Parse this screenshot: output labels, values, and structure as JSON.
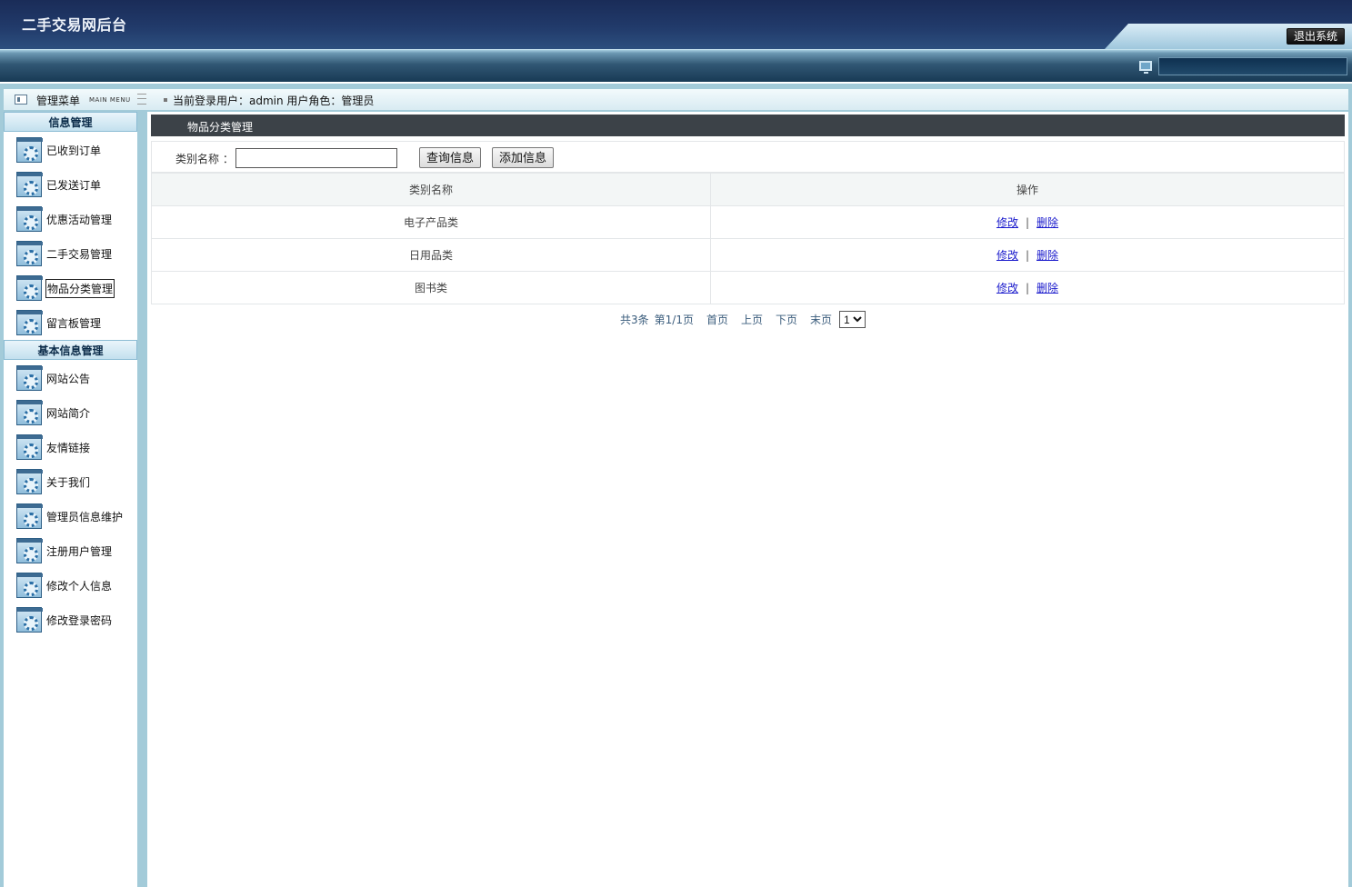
{
  "header": {
    "site_title": "二手交易网后台",
    "exit_label": "退出系统"
  },
  "frame_header": {
    "menu_title": "管理菜单",
    "menu_sub": "MAIN MENU",
    "user_info": "当前登录用户：admin  用户角色：管理员"
  },
  "sidebar": {
    "sections": [
      {
        "title": "信息管理",
        "items": [
          "已收到订单",
          "已发送订单",
          "优惠活动管理",
          "二手交易管理",
          "物品分类管理",
          "留言板管理"
        ]
      },
      {
        "title": "基本信息管理",
        "items": [
          "网站公告",
          "网站简介",
          "友情链接",
          "关于我们",
          "管理员信息维护",
          "注册用户管理",
          "修改个人信息",
          "修改登录密码"
        ]
      }
    ],
    "active_item": "物品分类管理"
  },
  "content": {
    "title": "物品分类管理",
    "search_label": "类别名称 ：",
    "search_value": "",
    "query_button": "查询信息",
    "add_button": "添加信息",
    "table": {
      "headers": [
        "类别名称",
        "操作"
      ],
      "rows": [
        {
          "name": "电子产品类",
          "edit": "修改",
          "delete": "删除"
        },
        {
          "name": "日用品类",
          "edit": "修改",
          "delete": "删除"
        },
        {
          "name": "图书类",
          "edit": "修改",
          "delete": "删除"
        }
      ]
    },
    "pager": {
      "total": "共3条",
      "page_info": "第1/1页",
      "first": "首页",
      "prev": "上页",
      "next": "下页",
      "last": "末页",
      "selected_page": "1"
    }
  },
  "colors": {
    "header_dark": "#1a2c58",
    "frame_blue": "#a3cbd9",
    "title_bar": "#3c4248",
    "link": "#1a1acc"
  }
}
